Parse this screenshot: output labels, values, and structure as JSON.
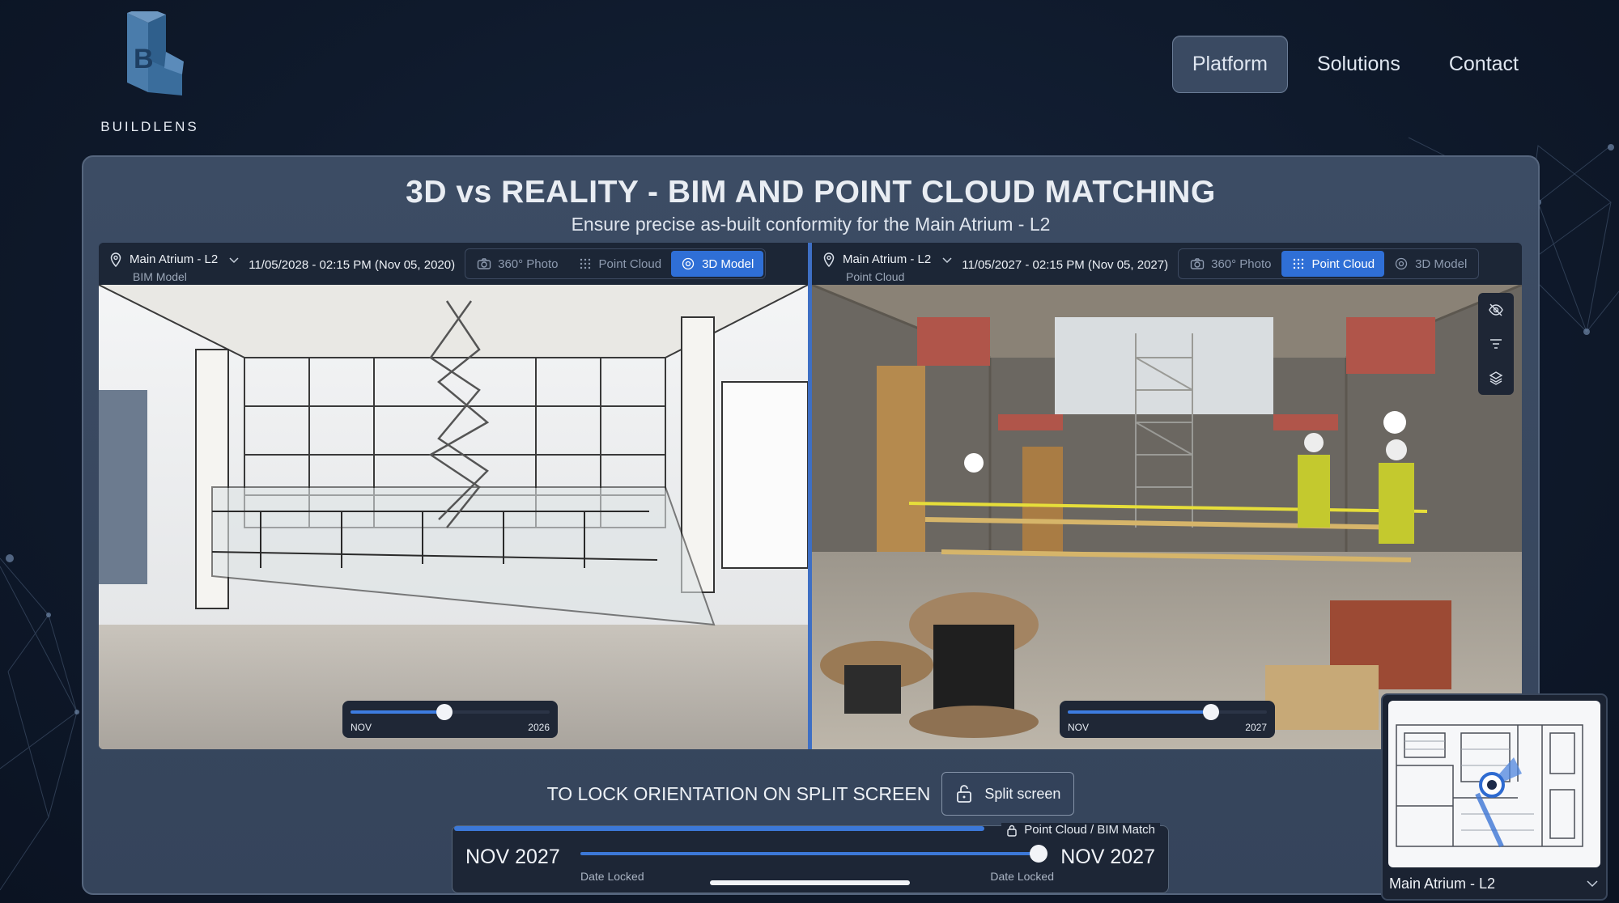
{
  "brand": {
    "name": "BUILDLENS",
    "logo_color": "#3c6e9e"
  },
  "nav": {
    "items": [
      {
        "label": "Platform",
        "active": true
      },
      {
        "label": "Solutions",
        "active": false
      },
      {
        "label": "Contact",
        "active": false
      }
    ]
  },
  "hero": {
    "title": "3D vs REALITY - BIM AND POINT CLOUD MATCHING",
    "subtitle": "Ensure precise as-built conformity for the Main Atrium - L2"
  },
  "left_pane": {
    "location": "Main Atrium - L2",
    "source": "BIM Model",
    "date": "11/05/2028 - 02:15 PM (Nov 05, 2020)",
    "modes": [
      {
        "label": "360° Photo",
        "icon": "camera-icon",
        "active": false
      },
      {
        "label": "Point Cloud",
        "icon": "dots-grid-icon",
        "active": false
      },
      {
        "label": "3D Model",
        "icon": "cube-icon",
        "active": true
      }
    ],
    "slider": {
      "start": "NOV",
      "end": "2026",
      "value": 0.47
    }
  },
  "right_pane": {
    "location": "Main Atrium - L2",
    "source": "Point Cloud",
    "date": "11/05/2027 - 02:15 PM (Nov 05, 2027)",
    "modes": [
      {
        "label": "360° Photo",
        "icon": "camera-icon",
        "active": false
      },
      {
        "label": "Point Cloud",
        "icon": "dots-grid-icon",
        "active": true
      },
      {
        "label": "3D Model",
        "icon": "cube-icon",
        "active": false
      }
    ],
    "slider": {
      "start": "NOV",
      "end": "2027",
      "value": 0.72
    },
    "side_tools": [
      "visibility-icon",
      "filter-icon",
      "layers-icon"
    ]
  },
  "lock": {
    "label": "TO LOCK ORIENTATION ON SPLIT SCREEN",
    "button": "Split screen"
  },
  "timeline": {
    "badge": "Point Cloud / BIM Match",
    "left_date": "NOV 2027",
    "right_date": "NOV 2027",
    "left_note": "Date Locked",
    "right_note": "Date Locked",
    "value": 1.0
  },
  "minimap": {
    "label": "Main Atrium - L2"
  },
  "colors": {
    "accent": "#2f6fd6",
    "panel": "#3a495f",
    "background": "#0f1a2c"
  }
}
